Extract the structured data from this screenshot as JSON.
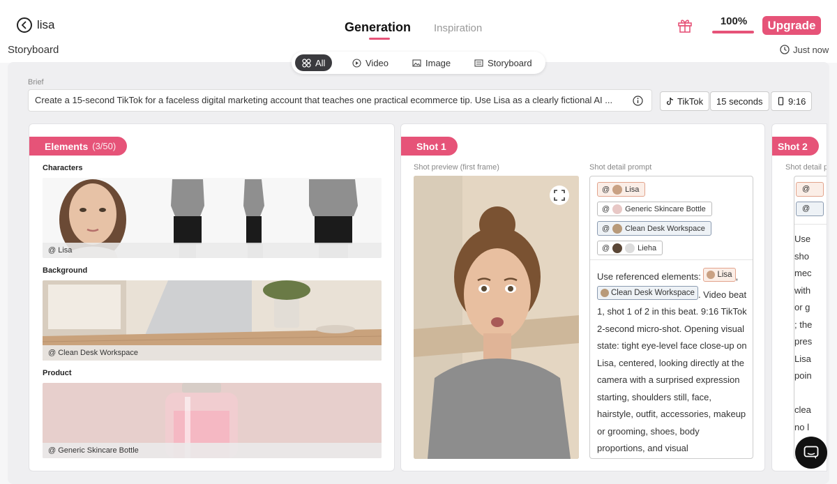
{
  "header": {
    "project_name": "lisa",
    "section_label": "Storyboard",
    "tabs": [
      "Generation",
      "Inspiration"
    ],
    "percent_label": "100%",
    "percent_value": 1.0,
    "upgrade_label": "Upgrade",
    "timestamp": "Just now"
  },
  "filters": [
    "All",
    "Video",
    "Image",
    "Storyboard"
  ],
  "brief": {
    "label": "Brief",
    "text": "Create a 15-second TikTok for a faceless digital marketing account that teaches one practical ecommerce tip. Use Lisa as a clearly fictional AI ..."
  },
  "settings": {
    "platform": "TikTok",
    "duration": "15 seconds",
    "ratio": "9:16"
  },
  "elements_panel": {
    "title": "Elements",
    "count": "(3/50)",
    "groups": [
      {
        "title": "Characters",
        "caption": "@ Lisa"
      },
      {
        "title": "Background",
        "caption": "@ Clean Desk Workspace"
      },
      {
        "title": "Product",
        "caption": "@ Generic Skincare Bottle"
      }
    ]
  },
  "shot": {
    "title": "Shot 1",
    "preview_label": "Shot preview (first frame)",
    "prompt_label": "Shot detail prompt",
    "refs": [
      {
        "label": "Lisa"
      },
      {
        "label": "Generic Skincare Bottle"
      },
      {
        "label": "Clean Desk Workspace"
      },
      {
        "label": "Lieha"
      }
    ],
    "prompt_intro": "Use referenced elements:",
    "prompt_tag1": "Lisa",
    "prompt_comma": ",",
    "prompt_tag2": "Clean Desk Workspace",
    "prompt_body": ". Video beat 1, shot 1 of 2 in this beat. 9:16 TikTok 2-second micro-shot. Opening visual state: tight eye-level face close-up on Lisa, centered, looking directly at the camera with a surprised expression starting, shoulders still, face, hairstyle, outfit, accessories, makeup or grooming, shoes, body proportions, and visual"
  },
  "shot2": {
    "title": "Shot 2",
    "prompt_label": "Shot detail prompt",
    "text_lines": [
      "Use",
      "sho",
      "mec",
      "with",
      "or g",
      "; the",
      "pres",
      "Lisa",
      "poin",
      "",
      "clea",
      "no l"
    ]
  },
  "colors": {
    "accent": "#e65378",
    "dark": "#3a3a3e"
  }
}
